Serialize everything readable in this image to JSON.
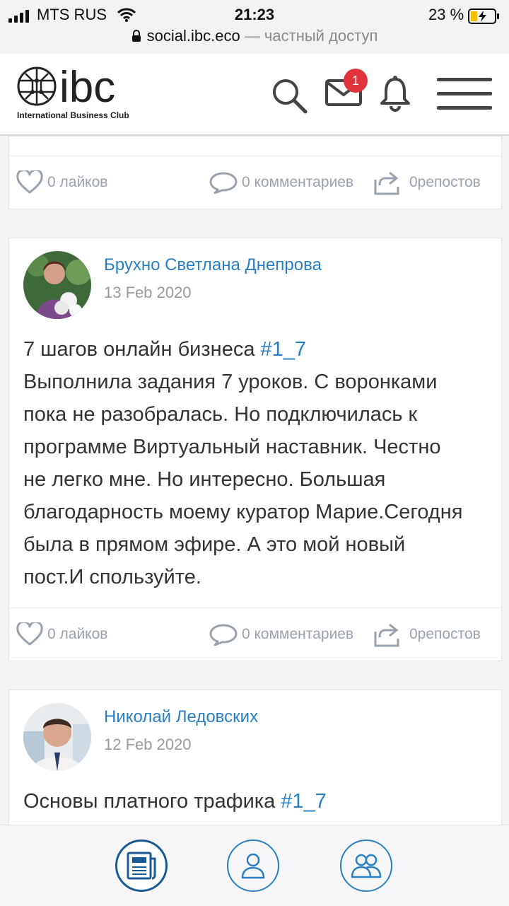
{
  "status_bar": {
    "carrier": "MTS RUS",
    "time": "21:23",
    "battery": "23 %",
    "url": "social.ibc.eco",
    "url_suffix": "— частный доступ"
  },
  "header": {
    "logo_text": "ibc",
    "logo_subtitle": "International Business Club",
    "messages_badge": "1"
  },
  "posts": [
    {
      "likes": "0 лайков",
      "comments": "0 комментариев",
      "reposts": "0репостов"
    },
    {
      "author": "Брухно Светлана Днепрова",
      "date": "13 Feb 2020",
      "title": "7 шагов онлайн бизнеса ",
      "hashtag": "#1_7",
      "lines": [
        "Выполнила задания 7 уроков. С воронками",
        "пока не разобралась. Но подключилась к",
        "программе Виртуальный наставник. Честно",
        "не легко мне. Но интересно. Большая",
        "благодарность моему куратор Марие.Сегодня",
        "была в прямом  эфире. А это мой новый",
        "пост.И спользуйте."
      ],
      "likes": "0 лайков",
      "comments": "0 комментариев",
      "reposts": "0репостов"
    },
    {
      "author": "Николай Ледовских",
      "date": "12 Feb 2020",
      "title": "Основы платного трафика ",
      "hashtag": "#1_7"
    }
  ],
  "colors": {
    "accent": "#2a7fc4",
    "badge": "#e0333b",
    "muted": "#9aa3ad"
  },
  "bottom_nav": [
    "newspaper-icon",
    "user-icon",
    "group-icon"
  ]
}
